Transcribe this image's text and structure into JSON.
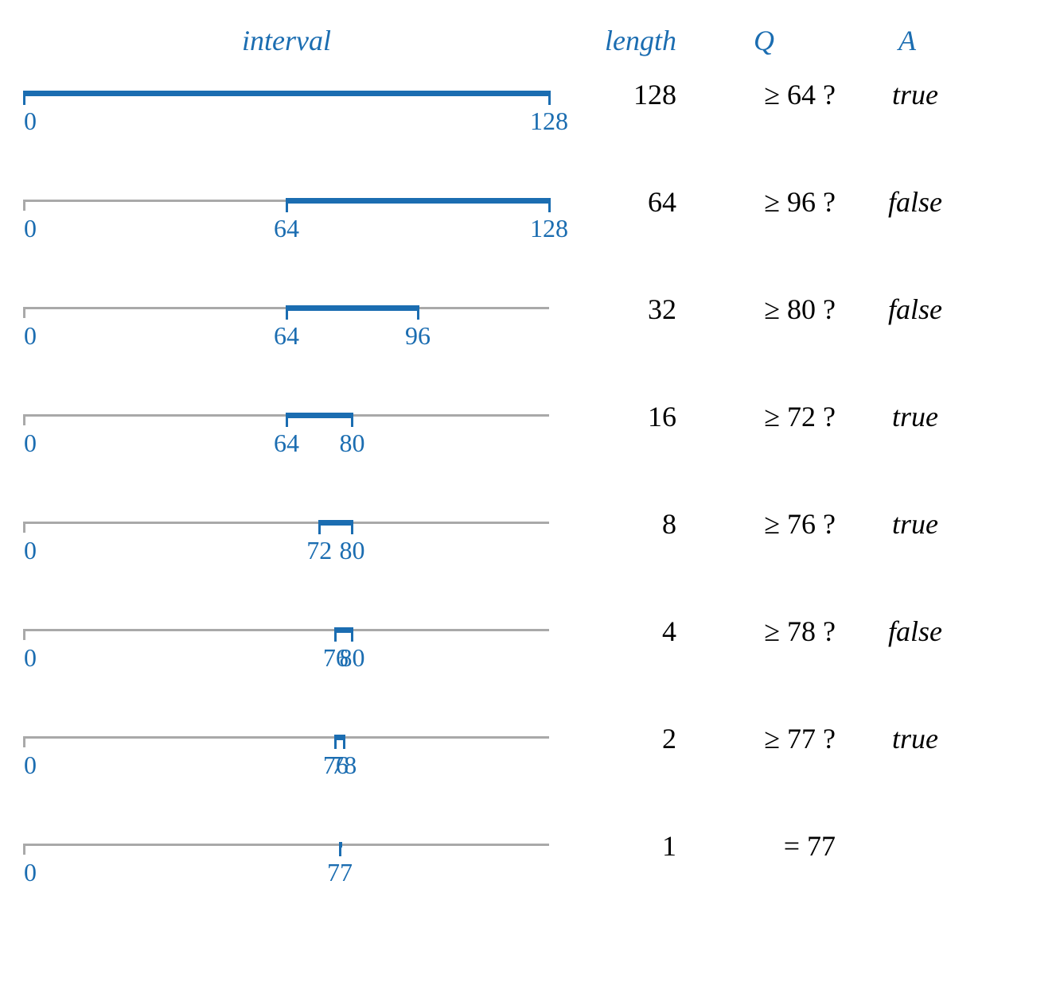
{
  "headers": {
    "interval": "interval",
    "length": "length",
    "q": "Q",
    "a": "A"
  },
  "domain_max": 128,
  "chart_data": {
    "type": "diagram",
    "description": "Binary search interval halving to find value 77 in range 0-128",
    "domain": [
      0,
      128
    ],
    "steps": [
      {
        "interval_start": 0,
        "interval_end": 128,
        "length": 128,
        "query": "≥ 64 ?",
        "answer": "true",
        "ticks": [
          {
            "pos": 0,
            "label": "0"
          },
          {
            "pos": 128,
            "label": "128"
          }
        ],
        "gray_start": null,
        "gray_end": null
      },
      {
        "interval_start": 64,
        "interval_end": 128,
        "length": 64,
        "query": "≥ 96 ?",
        "answer": "false",
        "ticks": [
          {
            "pos": 0,
            "label": "0"
          },
          {
            "pos": 64,
            "label": "64"
          },
          {
            "pos": 128,
            "label": "128"
          }
        ],
        "gray_start": 0,
        "gray_end": 128
      },
      {
        "interval_start": 64,
        "interval_end": 96,
        "length": 32,
        "query": "≥ 80 ?",
        "answer": "false",
        "ticks": [
          {
            "pos": 0,
            "label": "0"
          },
          {
            "pos": 64,
            "label": "64"
          },
          {
            "pos": 96,
            "label": "96"
          }
        ],
        "gray_start": 0,
        "gray_end": 128
      },
      {
        "interval_start": 64,
        "interval_end": 80,
        "length": 16,
        "query": "≥ 72 ?",
        "answer": "true",
        "ticks": [
          {
            "pos": 0,
            "label": "0"
          },
          {
            "pos": 64,
            "label": "64"
          },
          {
            "pos": 80,
            "label": "80"
          }
        ],
        "gray_start": 0,
        "gray_end": 128
      },
      {
        "interval_start": 72,
        "interval_end": 80,
        "length": 8,
        "query": "≥ 76 ?",
        "answer": "true",
        "ticks": [
          {
            "pos": 0,
            "label": "0"
          },
          {
            "pos": 72,
            "label": "72"
          },
          {
            "pos": 80,
            "label": "80"
          }
        ],
        "gray_start": 0,
        "gray_end": 128
      },
      {
        "interval_start": 76,
        "interval_end": 80,
        "length": 4,
        "query": "≥ 78 ?",
        "answer": "false",
        "ticks": [
          {
            "pos": 0,
            "label": "0"
          },
          {
            "pos": 76,
            "label": "76"
          },
          {
            "pos": 80,
            "label": "80"
          }
        ],
        "gray_start": 0,
        "gray_end": 128
      },
      {
        "interval_start": 76,
        "interval_end": 78,
        "length": 2,
        "query": "≥ 77 ?",
        "answer": "true",
        "ticks": [
          {
            "pos": 0,
            "label": "0"
          },
          {
            "pos": 76,
            "label": "76"
          },
          {
            "pos": 78,
            "label": "78"
          }
        ],
        "gray_start": 0,
        "gray_end": 128
      },
      {
        "interval_start": 77,
        "interval_end": 77,
        "length": 1,
        "query": "= 77",
        "answer": "",
        "ticks": [
          {
            "pos": 0,
            "label": "0"
          },
          {
            "pos": 77,
            "label": "77"
          }
        ],
        "gray_start": 0,
        "gray_end": 128
      }
    ]
  }
}
